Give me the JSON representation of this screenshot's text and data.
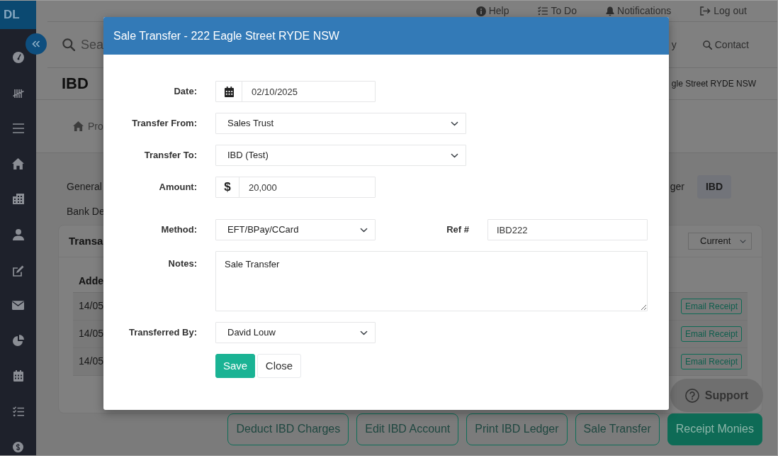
{
  "sidebar": {
    "logo": "DL"
  },
  "top_links": [
    {
      "label": "Help"
    },
    {
      "label": "To Do"
    },
    {
      "label": "Notifications"
    },
    {
      "label": "Log out"
    }
  ],
  "search": {
    "placeholder": "Sea"
  },
  "header_links": [
    {
      "label": "y"
    },
    {
      "label": "Contact"
    }
  ],
  "page_title": "IBD",
  "address": "gle Street RYDE NSW",
  "breadcrumb": [
    {
      "label": "Pro"
    }
  ],
  "tab_rows": [
    {
      "tabs": [
        {
          "label": "General",
          "selected": false
        },
        {
          "label": "ger",
          "selected": false
        },
        {
          "label": "IBD",
          "selected": true
        }
      ]
    },
    {
      "tabs": [
        {
          "label": "Bank De",
          "selected": false
        }
      ]
    }
  ],
  "card": {
    "title": "Transa",
    "filter": "Current",
    "table": {
      "columns": [
        "Adde"
      ],
      "rows": [
        {
          "cells": [
            "14/05"
          ],
          "action": "Email Receipt"
        },
        {
          "cells": [
            "14/05"
          ],
          "action": "Email Receipt"
        },
        {
          "cells": [
            "14/05"
          ],
          "action": "Email Receipt"
        }
      ]
    }
  },
  "support": {
    "label": "Support"
  },
  "actions": [
    {
      "label": "Deduct IBD Charges",
      "primary": false
    },
    {
      "label": "Edit IBD Account",
      "primary": false
    },
    {
      "label": "Print IBD Ledger",
      "primary": false
    },
    {
      "label": "Sale Transfer",
      "primary": false
    },
    {
      "label": "Receipt Monies",
      "primary": true
    }
  ],
  "modal": {
    "title": "Sale Transfer - 222 Eagle Street RYDE NSW",
    "fields": [
      {
        "kind": "date",
        "label": "Date:",
        "value": "02/10/2025"
      },
      {
        "kind": "select",
        "label": "Transfer From:",
        "value": "Sales Trust"
      },
      {
        "kind": "select",
        "label": "Transfer To:",
        "value": "IBD (Test)"
      },
      {
        "kind": "money",
        "label": "Amount:",
        "currency": "$",
        "value": "20,000"
      },
      {
        "kind": "select",
        "label": "Method:",
        "value": "EFT/BPay/CCard",
        "ref": {
          "label": "Ref #",
          "value": "IBD222"
        }
      },
      {
        "kind": "textarea",
        "label": "Notes:",
        "value": "Sale Transfer"
      },
      {
        "kind": "select",
        "label": "Transferred By:",
        "value": "David Louw"
      }
    ],
    "buttons": [
      {
        "label": "Save",
        "primary": true
      },
      {
        "label": "Close",
        "primary": false
      }
    ]
  }
}
